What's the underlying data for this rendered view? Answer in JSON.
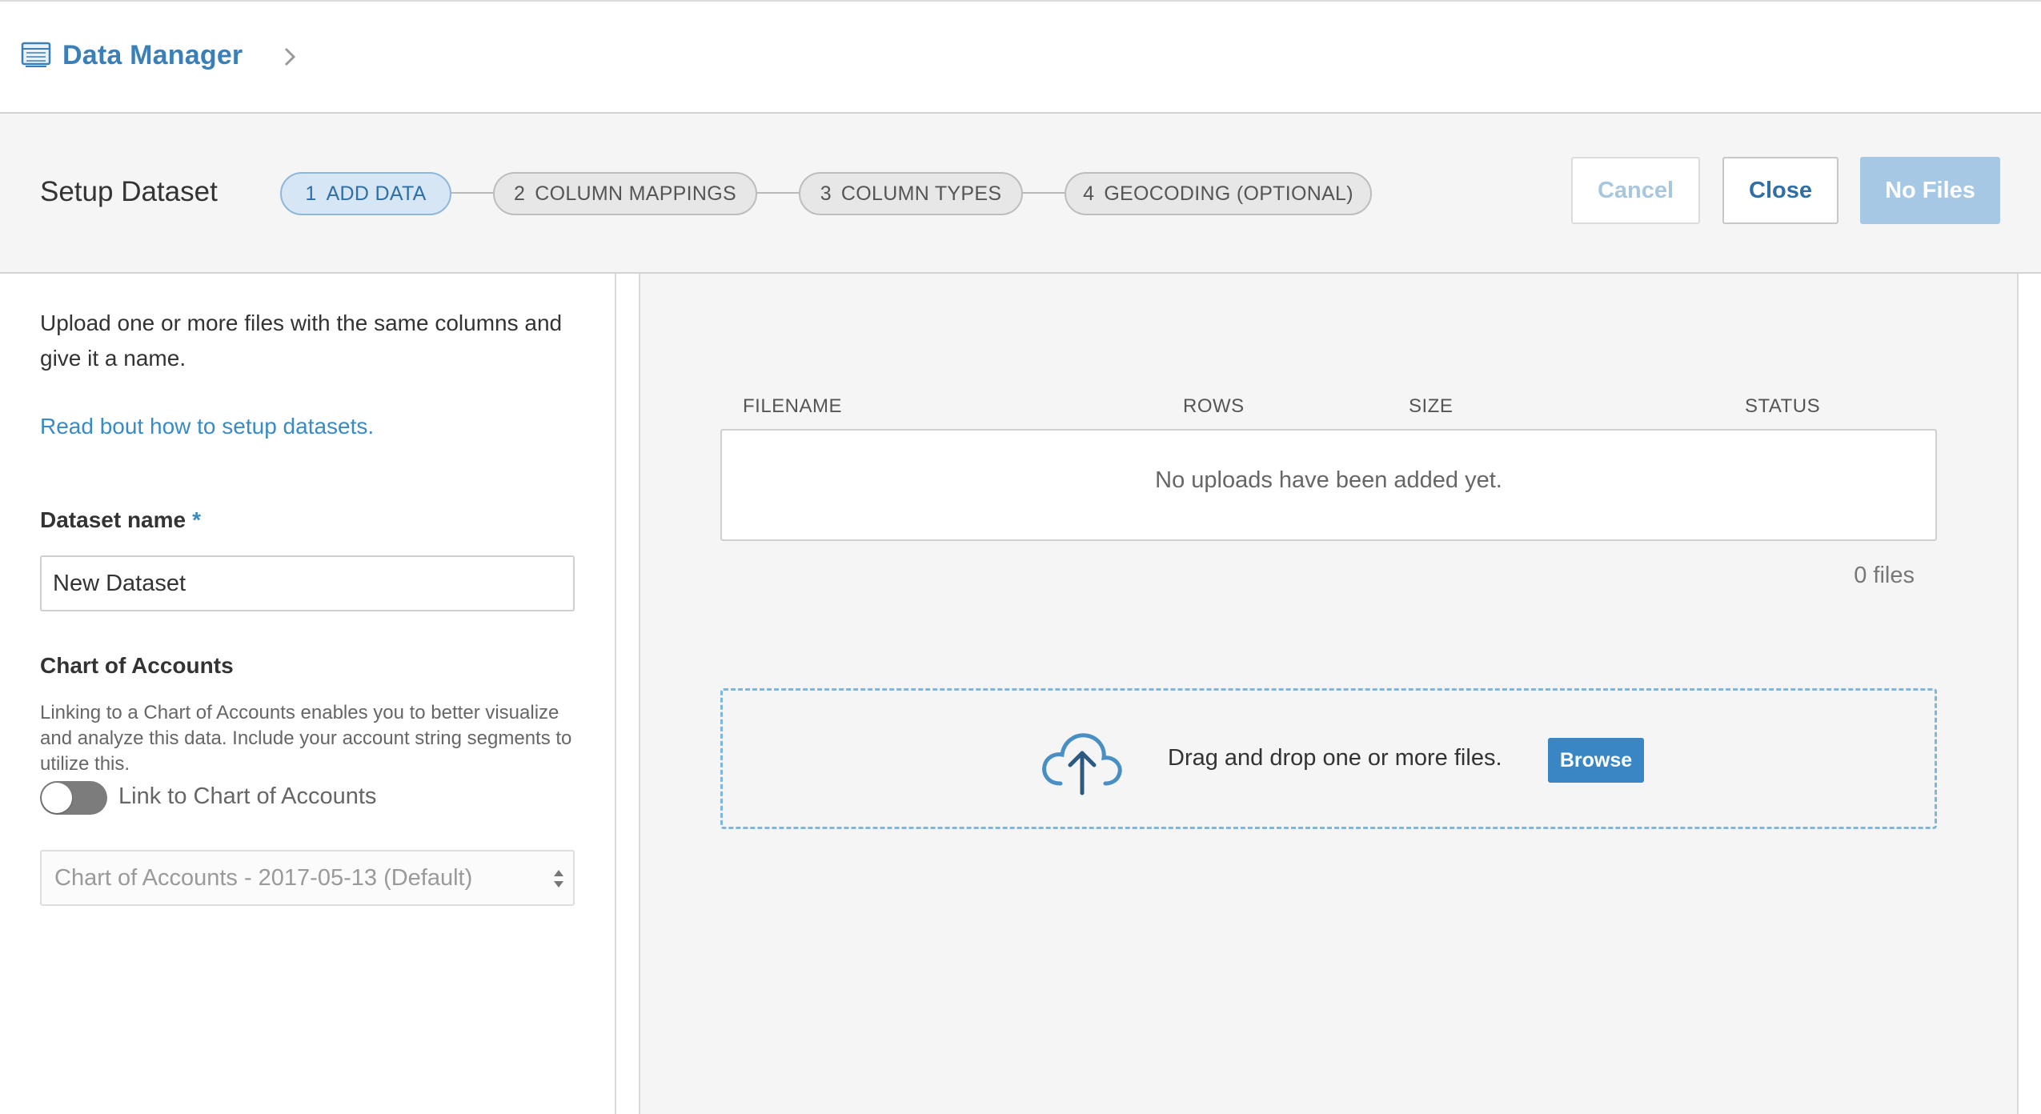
{
  "app": {
    "title": "Data Manager",
    "icon": "spreadsheet-icon"
  },
  "wizard": {
    "title": "Setup Dataset",
    "steps": [
      {
        "number": "1",
        "label": "ADD DATA",
        "active": true
      },
      {
        "number": "2",
        "label": "COLUMN MAPPINGS",
        "active": false
      },
      {
        "number": "3",
        "label": "COLUMN TYPES",
        "active": false
      },
      {
        "number": "4",
        "label": "GEOCODING (OPTIONAL)",
        "active": false
      }
    ],
    "buttons": {
      "cancel": "Cancel",
      "close": "Close",
      "submit": "No Files"
    }
  },
  "left": {
    "intro": "Upload one or more files with the same columns and give it a name.",
    "help_link": "Read bout how to setup datasets.",
    "dataset_name_label": "Dataset name",
    "required_mark": "*",
    "dataset_name_value": "New Dataset",
    "coa_title": "Chart of Accounts",
    "coa_description": "Linking to a Chart of Accounts enables you to better visualize and analyze this data. Include your account string segments to utilize this.",
    "toggle_label": "Link to Chart of Accounts",
    "toggle_on": false,
    "coa_select_value": "Chart of Accounts - 2017-05-13 (Default)"
  },
  "uploads": {
    "columns": [
      "FILENAME",
      "ROWS",
      "SIZE",
      "STATUS"
    ],
    "empty_message": "No uploads have been added yet.",
    "file_count": "0 files",
    "drop_text": "Drag and drop one or more files.",
    "browse_label": "Browse"
  },
  "colors": {
    "accent": "#3a86c4",
    "active_step_bg": "#d6e6f4",
    "disabled_primary": "#a6c8e5"
  }
}
